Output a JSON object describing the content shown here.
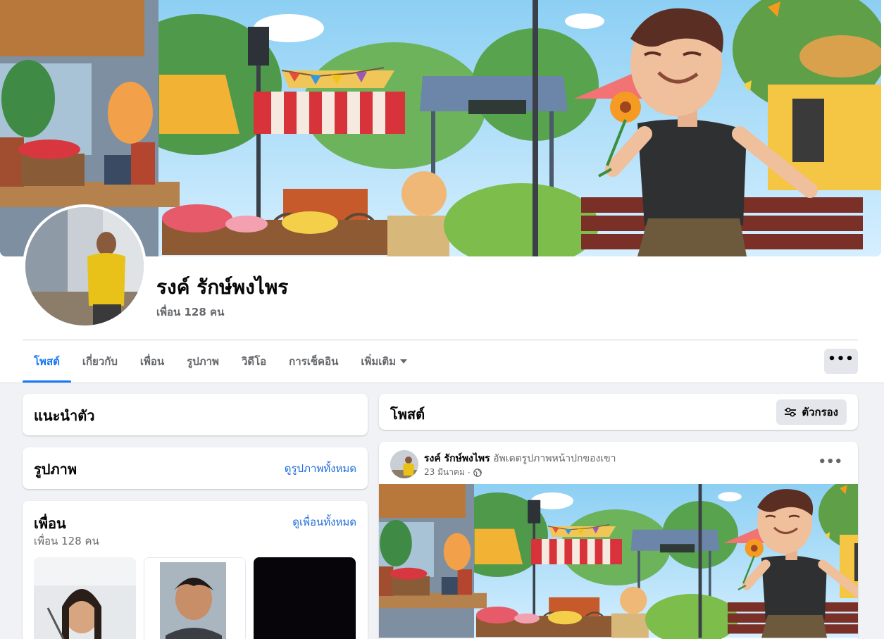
{
  "profile": {
    "name": "รงค์ รักษ์พงไพร",
    "friends_count": "เพื่อน 128 คน"
  },
  "tabs": [
    {
      "label": "โพสต์",
      "active": true
    },
    {
      "label": "เกี่ยวกับ",
      "active": false
    },
    {
      "label": "เพื่อน",
      "active": false
    },
    {
      "label": "รูปภาพ",
      "active": false
    },
    {
      "label": "วิดีโอ",
      "active": false
    },
    {
      "label": "การเช็คอิน",
      "active": false
    },
    {
      "label": "เพิ่มเติม",
      "active": false
    }
  ],
  "more_button": {
    "icon": "more-horizontal-icon",
    "text": "•••"
  },
  "intro_card": {
    "title": "แนะนำตัว"
  },
  "photos_card": {
    "title": "รูปภาพ",
    "link": "ดูรูปภาพทั้งหมด"
  },
  "friends_card": {
    "title": "เพื่อน",
    "link": "ดูเพื่อนทั้งหมด",
    "subtitle": "เพื่อน 128 คน"
  },
  "posts_header": {
    "title": "โพสต์",
    "filter_label": "ตัวกรอง",
    "filter_icon": "sliders-icon"
  },
  "post": {
    "author": "รงค์ รักษ์พงไพร",
    "action": "อัพเดตรูปภาพหน้าปกของเขา",
    "date": "23 มีนาคม",
    "separator": "·",
    "audience_icon": "globe-icon",
    "more_text": "•••"
  },
  "colors": {
    "accent": "#1877f2",
    "link": "#216fdb",
    "background": "#f0f2f5",
    "secondary_text": "#65676b"
  }
}
